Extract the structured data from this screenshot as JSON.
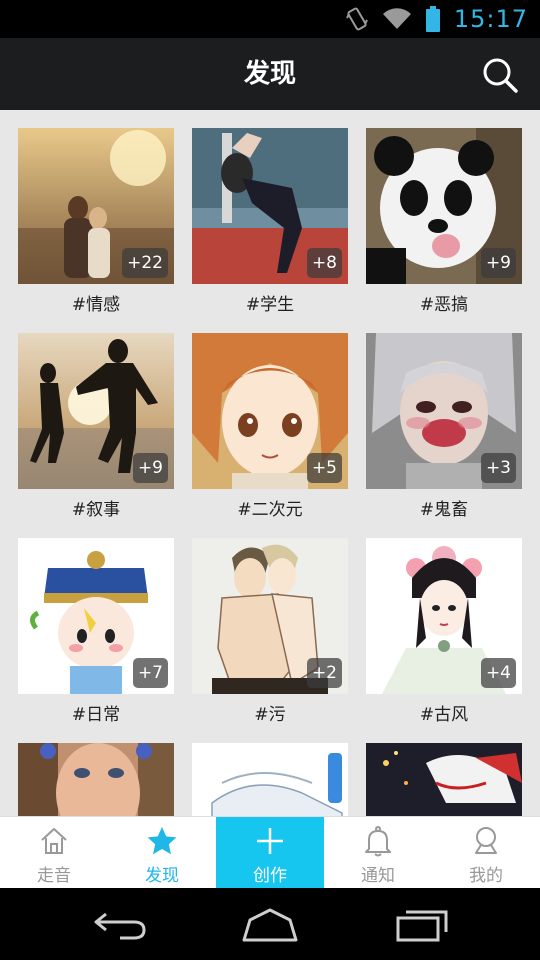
{
  "status_bar": {
    "time": "15:17"
  },
  "header": {
    "title": "发现"
  },
  "tags": [
    {
      "label": "#情感",
      "count": "+22"
    },
    {
      "label": "#学生",
      "count": "+8"
    },
    {
      "label": "#恶搞",
      "count": "+9"
    },
    {
      "label": "#叙事",
      "count": "+9"
    },
    {
      "label": "#二次元",
      "count": "+5"
    },
    {
      "label": "#鬼畜",
      "count": "+3"
    },
    {
      "label": "#日常",
      "count": "+7"
    },
    {
      "label": "#污",
      "count": "+2"
    },
    {
      "label": "#古风",
      "count": "+4"
    }
  ],
  "tabs": [
    {
      "label": "走音",
      "icon": "home-icon",
      "active": false
    },
    {
      "label": "发现",
      "icon": "star-icon",
      "active": true
    },
    {
      "label": "创作",
      "icon": "plus-icon",
      "active": false
    },
    {
      "label": "通知",
      "icon": "bell-icon",
      "active": false
    },
    {
      "label": "我的",
      "icon": "person-icon",
      "active": false
    }
  ],
  "colors": {
    "accent": "#1fb8e6",
    "create_tab": "#16c6ee",
    "status_blue": "#33b5e5",
    "header_bg": "#1b1d1f"
  }
}
